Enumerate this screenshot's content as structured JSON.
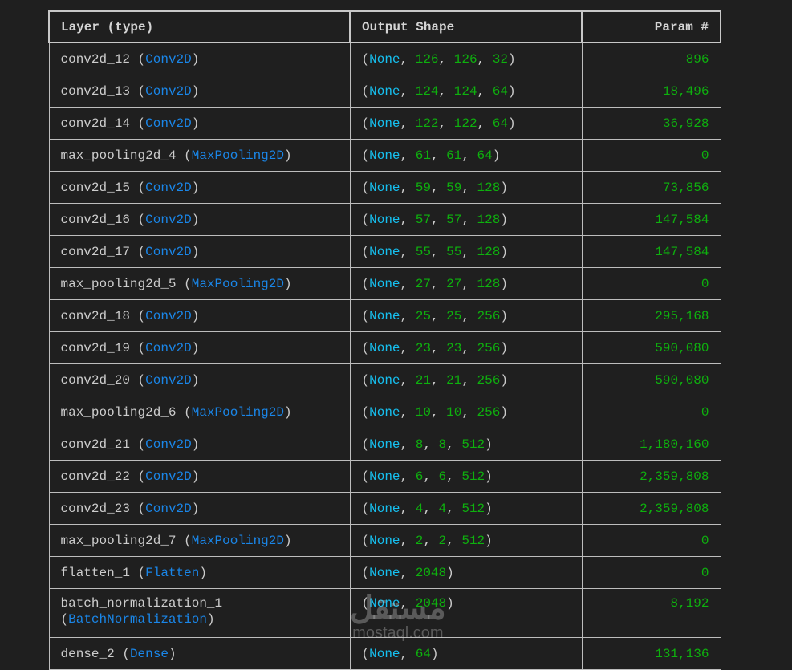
{
  "header": {
    "layer": "Layer (type)",
    "shape": "Output Shape",
    "params": "Param #"
  },
  "rows": [
    {
      "name": "conv2d_12",
      "type": "Conv2D",
      "shape": [
        "None",
        "126",
        "126",
        "32"
      ],
      "params": "896"
    },
    {
      "name": "conv2d_13",
      "type": "Conv2D",
      "shape": [
        "None",
        "124",
        "124",
        "64"
      ],
      "params": "18,496"
    },
    {
      "name": "conv2d_14",
      "type": "Conv2D",
      "shape": [
        "None",
        "122",
        "122",
        "64"
      ],
      "params": "36,928"
    },
    {
      "name": "max_pooling2d_4",
      "type": "MaxPooling2D",
      "shape": [
        "None",
        "61",
        "61",
        "64"
      ],
      "params": "0"
    },
    {
      "name": "conv2d_15",
      "type": "Conv2D",
      "shape": [
        "None",
        "59",
        "59",
        "128"
      ],
      "params": "73,856"
    },
    {
      "name": "conv2d_16",
      "type": "Conv2D",
      "shape": [
        "None",
        "57",
        "57",
        "128"
      ],
      "params": "147,584"
    },
    {
      "name": "conv2d_17",
      "type": "Conv2D",
      "shape": [
        "None",
        "55",
        "55",
        "128"
      ],
      "params": "147,584"
    },
    {
      "name": "max_pooling2d_5",
      "type": "MaxPooling2D",
      "shape": [
        "None",
        "27",
        "27",
        "128"
      ],
      "params": "0"
    },
    {
      "name": "conv2d_18",
      "type": "Conv2D",
      "shape": [
        "None",
        "25",
        "25",
        "256"
      ],
      "params": "295,168"
    },
    {
      "name": "conv2d_19",
      "type": "Conv2D",
      "shape": [
        "None",
        "23",
        "23",
        "256"
      ],
      "params": "590,080"
    },
    {
      "name": "conv2d_20",
      "type": "Conv2D",
      "shape": [
        "None",
        "21",
        "21",
        "256"
      ],
      "params": "590,080"
    },
    {
      "name": "max_pooling2d_6",
      "type": "MaxPooling2D",
      "shape": [
        "None",
        "10",
        "10",
        "256"
      ],
      "params": "0"
    },
    {
      "name": "conv2d_21",
      "type": "Conv2D",
      "shape": [
        "None",
        "8",
        "8",
        "512"
      ],
      "params": "1,180,160"
    },
    {
      "name": "conv2d_22",
      "type": "Conv2D",
      "shape": [
        "None",
        "6",
        "6",
        "512"
      ],
      "params": "2,359,808"
    },
    {
      "name": "conv2d_23",
      "type": "Conv2D",
      "shape": [
        "None",
        "4",
        "4",
        "512"
      ],
      "params": "2,359,808"
    },
    {
      "name": "max_pooling2d_7",
      "type": "MaxPooling2D",
      "shape": [
        "None",
        "2",
        "2",
        "512"
      ],
      "params": "0"
    },
    {
      "name": "flatten_1",
      "type": "Flatten",
      "shape": [
        "None",
        "2048"
      ],
      "params": "0"
    },
    {
      "name": "batch_normalization_1",
      "type": "BatchNormalization",
      "shape": [
        "None",
        "2048"
      ],
      "params": "8,192",
      "wrap": true
    },
    {
      "name": "dense_2",
      "type": "Dense",
      "shape": [
        "None",
        "64"
      ],
      "params": "131,136"
    }
  ],
  "watermark": {
    "arabic": "مستقل",
    "latin": "mostaql.com"
  },
  "colors": {
    "background": "#1f1f1f",
    "text": "#cccccc",
    "type": "#1a86e8",
    "none": "#16c0f0",
    "number": "#0eb00e"
  }
}
